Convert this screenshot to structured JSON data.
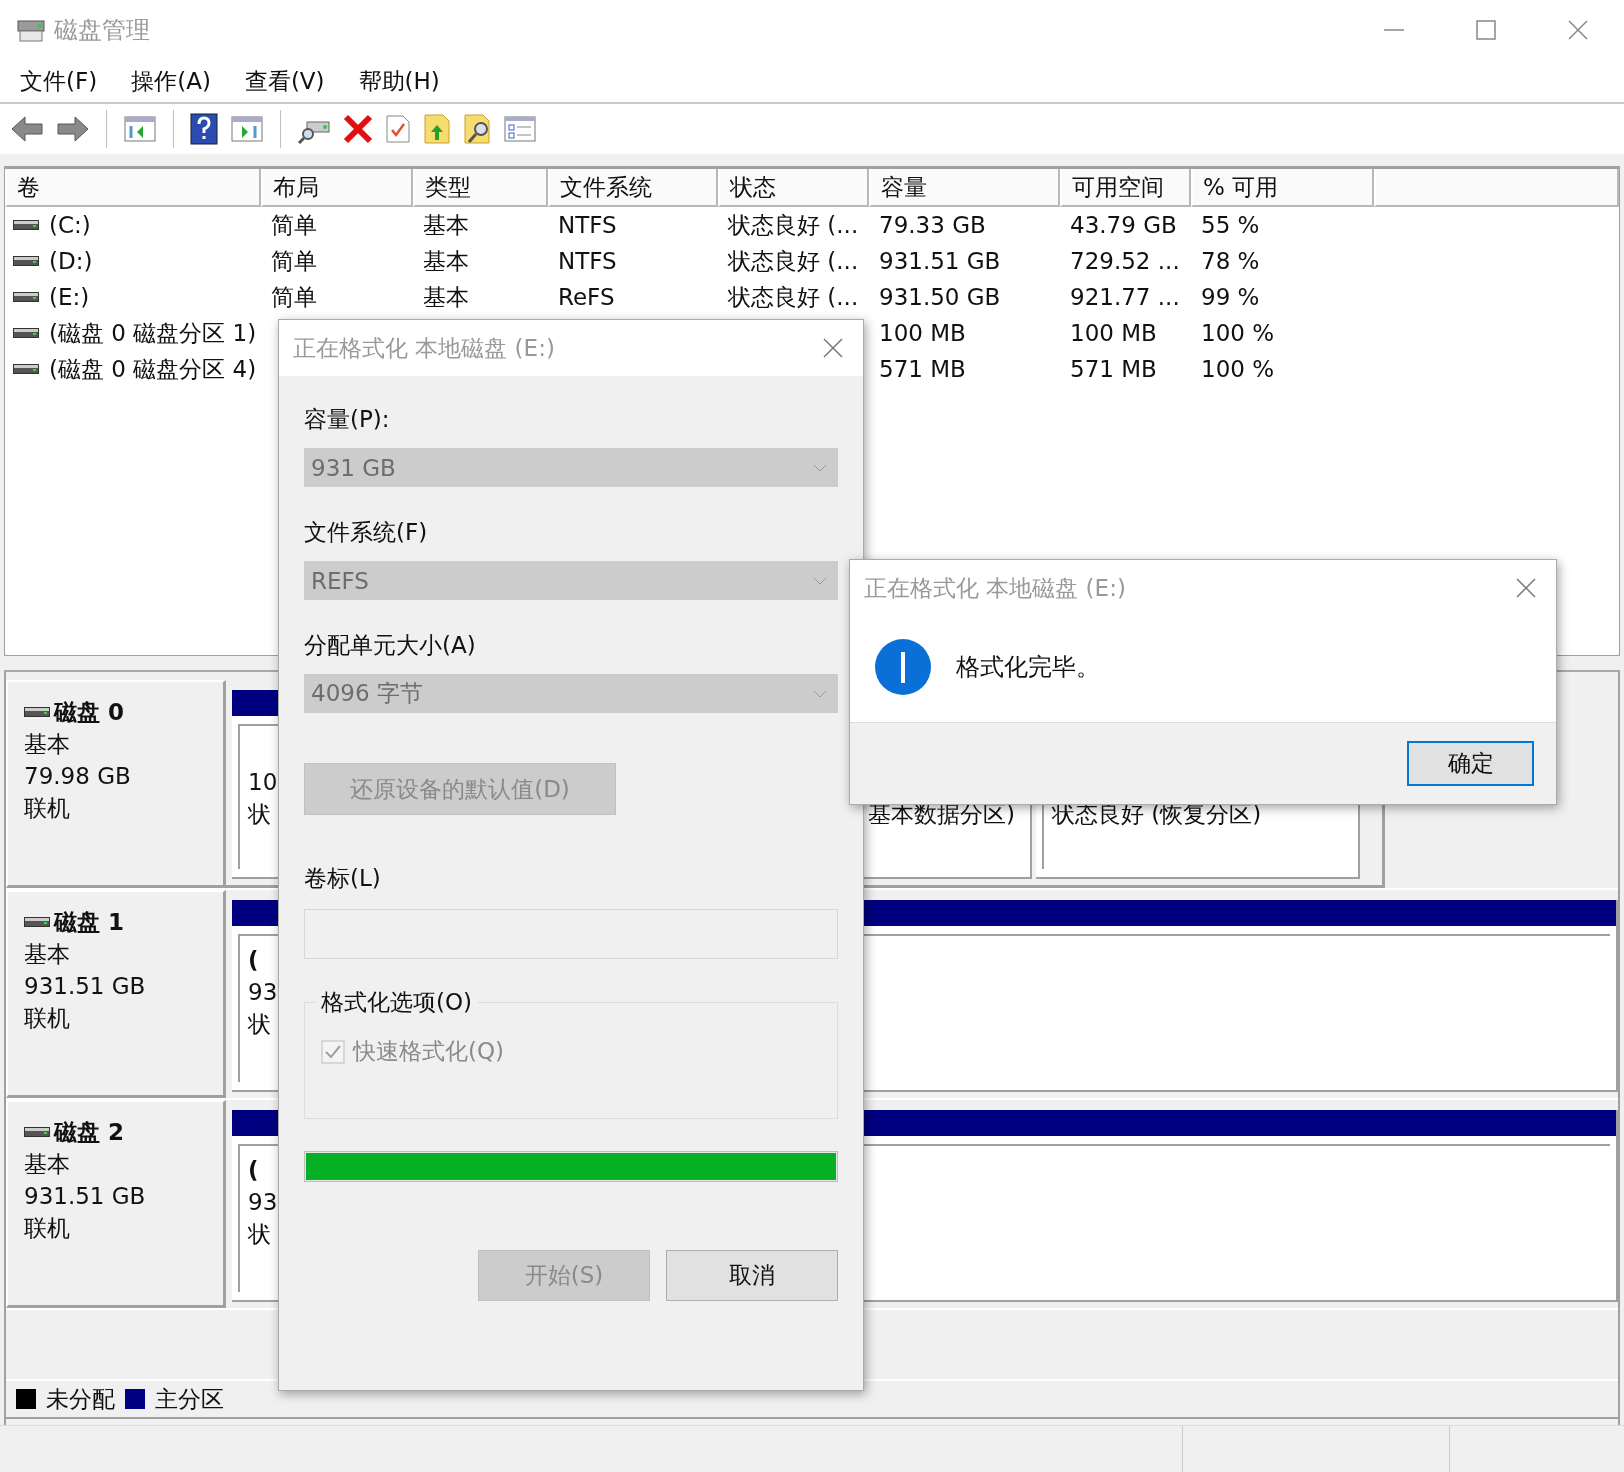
{
  "window": {
    "title": "磁盘管理"
  },
  "menu": [
    "文件(F)",
    "操作(A)",
    "查看(V)",
    "帮助(H)"
  ],
  "volumes_table": {
    "columns": [
      "卷",
      "布局",
      "类型",
      "文件系统",
      "状态",
      "容量",
      "可用空间",
      "% 可用"
    ],
    "rows": [
      {
        "volume": "(C:)",
        "layout": "简单",
        "type": "基本",
        "file_system": "NTFS",
        "status": "状态良好 (...",
        "capacity": "79.33 GB",
        "free": "43.79 GB",
        "percent_free": "55 %"
      },
      {
        "volume": "(D:)",
        "layout": "简单",
        "type": "基本",
        "file_system": "NTFS",
        "status": "状态良好 (...",
        "capacity": "931.51 GB",
        "free": "729.52 ...",
        "percent_free": "78 %"
      },
      {
        "volume": "(E:)",
        "layout": "简单",
        "type": "基本",
        "file_system": "ReFS",
        "status": "状态良好 (...",
        "capacity": "931.50 GB",
        "free": "921.77 ...",
        "percent_free": "99 %"
      },
      {
        "volume": "(磁盘 0 磁盘分区 1)",
        "capacity": "100 MB",
        "free": "100 MB",
        "percent_free": "100 %"
      },
      {
        "volume": "(磁盘 0 磁盘分区 4)",
        "capacity": "571 MB",
        "free": "571 MB",
        "percent_free": "100 %"
      }
    ]
  },
  "disks": [
    {
      "name": "磁盘 0",
      "type": "基本",
      "size": "79.98 GB",
      "status": "联机",
      "partitions": [
        {
          "size": "10",
          "status": "状"
        },
        {
          "status": "基本数据分区)"
        },
        {
          "status": "状态良好 (恢复分区)"
        }
      ]
    },
    {
      "name": "磁盘 1",
      "type": "基本",
      "size": "931.51 GB",
      "status": "联机",
      "partitions": [
        {
          "name": "(",
          "size": "93",
          "status": "状"
        }
      ]
    },
    {
      "name": "磁盘 2",
      "type": "基本",
      "size": "931.51 GB",
      "status": "联机",
      "partitions": [
        {
          "name": "(",
          "size": "93",
          "status": "状"
        }
      ]
    }
  ],
  "legend": [
    {
      "label": "未分配",
      "color": "#000000"
    },
    {
      "label": "主分区",
      "color": "#000080"
    }
  ],
  "format_dialog": {
    "title": "正在格式化 本地磁盘 (E:)",
    "fields": [
      {
        "label": "容量(P):",
        "value": "931 GB",
        "disabled": true
      },
      {
        "label": "文件系统(F)",
        "value": "REFS",
        "disabled": true
      },
      {
        "label": "分配单元大小(A)",
        "value": "4096 字节",
        "disabled": true
      }
    ],
    "restore_button": {
      "label": "还原设备的默认值(D)",
      "disabled": true
    },
    "volume_label": {
      "label": "卷标(L)",
      "disabled": true
    },
    "options": {
      "title": "格式化选项(O)",
      "quick_format": {
        "label": "快速格式化(Q)",
        "checked": true,
        "disabled": true
      }
    },
    "progress": {
      "level": 1
    },
    "buttons": [
      {
        "label": "开始(S)",
        "disabled": true
      },
      {
        "label": "取消",
        "disabled": false
      }
    ]
  },
  "message_dialog": {
    "title": "正在格式化 本地磁盘 (E:)",
    "message": "格式化完毕。",
    "buttons": [
      {
        "label": "确定",
        "default": true
      }
    ]
  }
}
